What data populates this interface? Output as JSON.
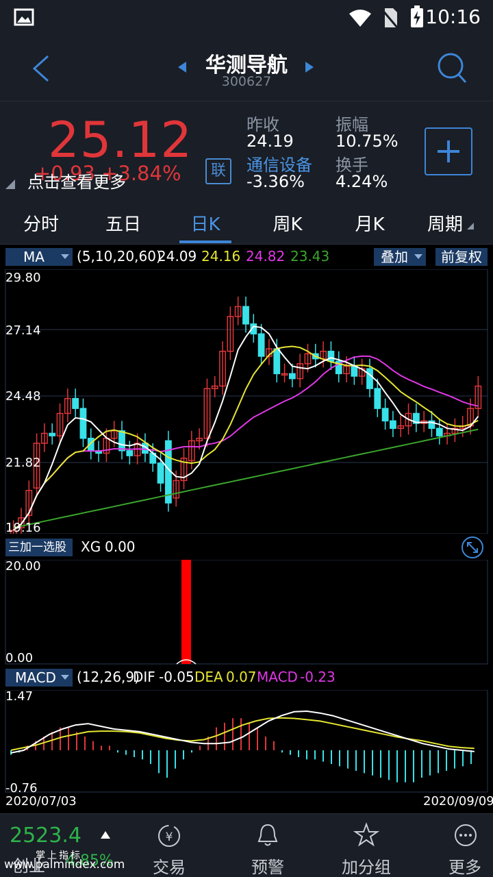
{
  "status": {
    "time": "10:16"
  },
  "header": {
    "title": "华测导航",
    "code": "300627"
  },
  "quote": {
    "price": "25.12",
    "change": "+0.93  +3.84%",
    "tip": "点击查看更多",
    "prev_close_label": "昨收",
    "prev_close": "24.19",
    "amplitude_label": "振幅",
    "amplitude": "10.75%",
    "sector_label": "通信设备",
    "sector_change": "-3.36%",
    "turnover_label": "换手",
    "turnover": "4.24%",
    "link_label": "联"
  },
  "tabs": [
    "分时",
    "五日",
    "日K",
    "周K",
    "月K",
    "周期"
  ],
  "ma": {
    "label": "MA",
    "params": "(5,10,20,60)",
    "v1": "24.09",
    "v2": "24.16",
    "v3": "24.82",
    "v4": "23.43",
    "overlay": "叠加",
    "adjust": "前复权",
    "axis": [
      "29.80",
      "27.14",
      "24.48",
      "21.82",
      "19.16"
    ]
  },
  "xg": {
    "label": "三加一选股",
    "name": "XG",
    "value": "0.00",
    "axis_top": "20.00",
    "axis_bottom": "0.00"
  },
  "macd": {
    "label": "MACD",
    "params": "(12,26,9)",
    "dif_label": "DIF",
    "dif": "-0.05",
    "dea_label": "DEA",
    "dea": "0.07",
    "macd_label": "MACD",
    "macd": "-0.23",
    "axis_top": "1.47",
    "axis_bottom": "-0.76",
    "date_start": "2020/07/03",
    "date_end": "2020/09/09"
  },
  "bottom": {
    "index_value": "2523.4",
    "index_name": "创业",
    "index_change": "4.85%",
    "items": [
      "交易",
      "预警",
      "加分组",
      "更多"
    ],
    "watermark": "www.palmindex.com"
  },
  "colors": {
    "up": "#e0363a",
    "down": "#39e1e8",
    "ma5": "#ffffff",
    "ma10": "#e6e633",
    "ma20": "#e038e6",
    "ma60": "#3aa62c",
    "accent": "#3d86d8"
  }
}
